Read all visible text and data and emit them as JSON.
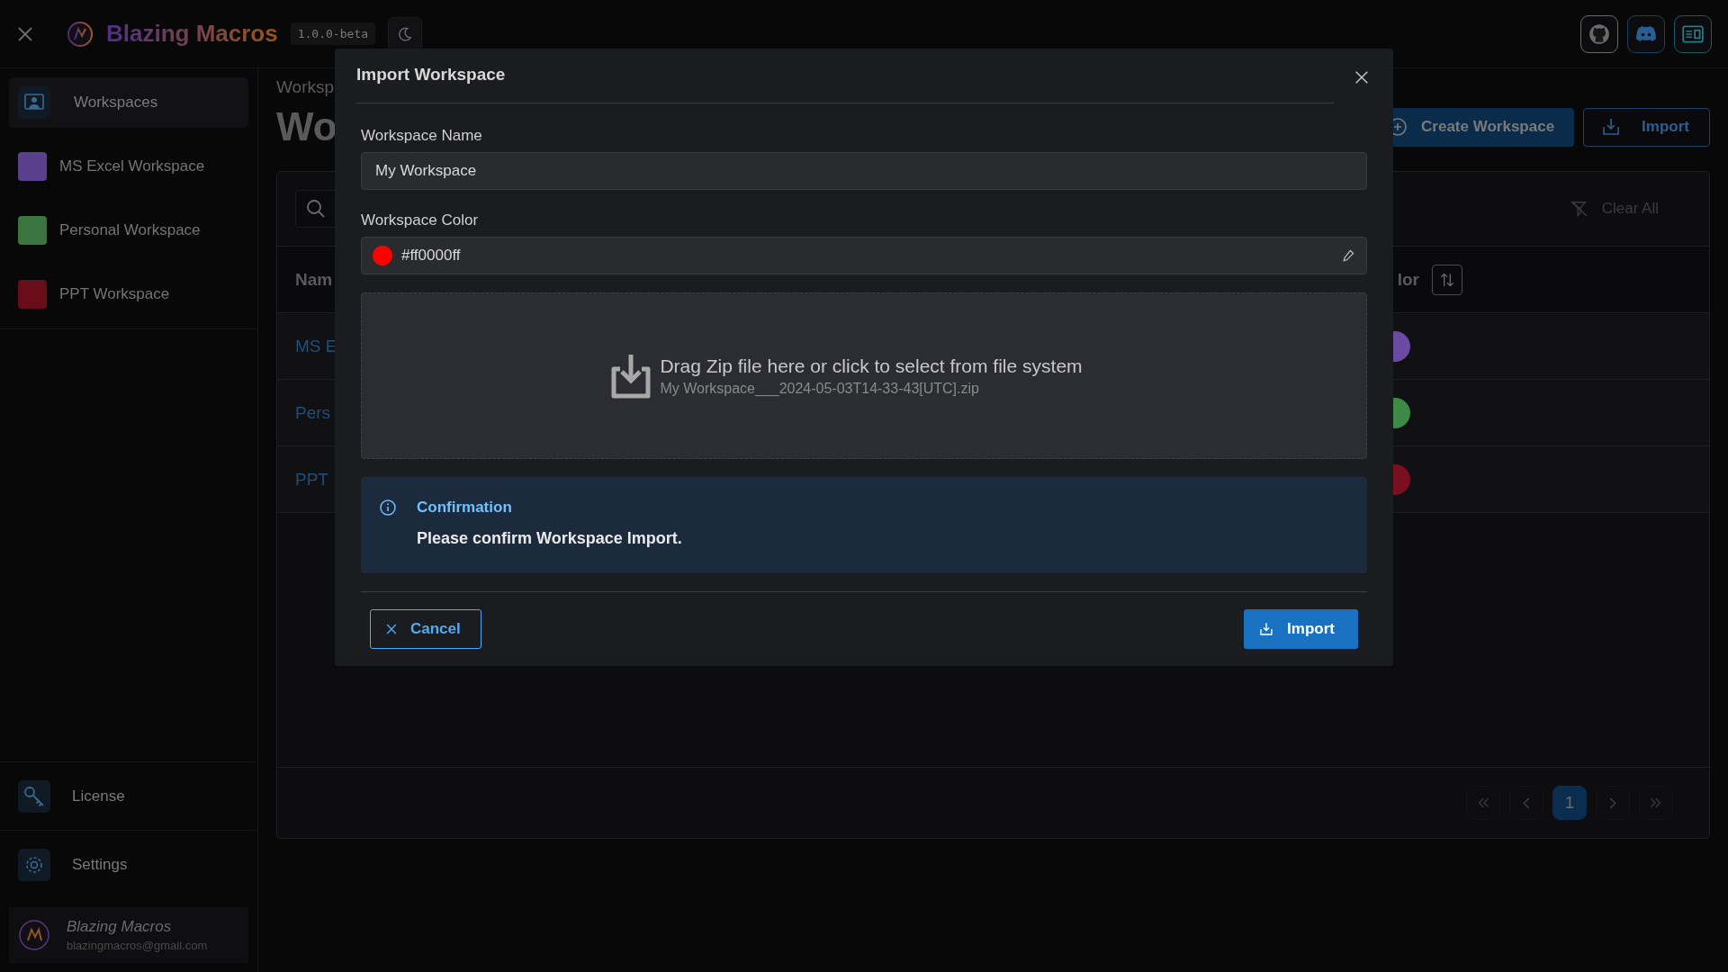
{
  "app": {
    "title": "Blazing Macros",
    "version": "1.0.0-beta"
  },
  "sidebar": {
    "items": [
      {
        "kind": "nav",
        "label": "Workspaces",
        "selected": true
      },
      {
        "kind": "workspace",
        "label": "MS Excel Workspace",
        "color": "#5a3f8c",
        "selected": false
      },
      {
        "kind": "workspace",
        "label": "Personal Workspace",
        "color": "#3a7540",
        "selected": false
      },
      {
        "kind": "workspace",
        "label": "PPT Workspace",
        "color": "#6a0d1a",
        "selected": false
      }
    ],
    "bottom_items": [
      {
        "label": "License"
      },
      {
        "label": "Settings"
      }
    ],
    "user": {
      "name": "Blazing Macros",
      "email": "blazingmacros@gmail.com"
    }
  },
  "main": {
    "breadcrumb": "Worksp",
    "title": "Wo",
    "buttons": [
      {
        "kind": "create",
        "label": "Create Workspace"
      },
      {
        "kind": "import",
        "label": "Import"
      }
    ],
    "table": {
      "clear_filter": "Clear All",
      "columns": [
        "Nam",
        "lor"
      ],
      "rows": [
        {
          "name": "MS E",
          "color": "#6a4aa3"
        },
        {
          "name": "Pers",
          "color": "#3d8a46"
        },
        {
          "name": "PPT",
          "color": "#7a0f20"
        }
      ],
      "pagination": [
        {
          "label": "1",
          "selected": true
        }
      ]
    }
  },
  "dialog": {
    "title": "Import Workspace",
    "name_label": "Workspace Name",
    "name_value": "My Workspace",
    "color_label": "Workspace Color",
    "color_value": "#ff0000ff",
    "color": "#ff0000",
    "dropzone": {
      "text": "Drag Zip file here or click to select from file system",
      "file": "My Workspace___2024-05-03T14-33-43[UTC].zip"
    },
    "alert": {
      "title": "Confirmation",
      "message": "Please confirm Workspace Import."
    },
    "buttons": [
      {
        "kind": "cancel",
        "label": "Cancel"
      },
      {
        "kind": "import",
        "label": "Import"
      }
    ]
  }
}
